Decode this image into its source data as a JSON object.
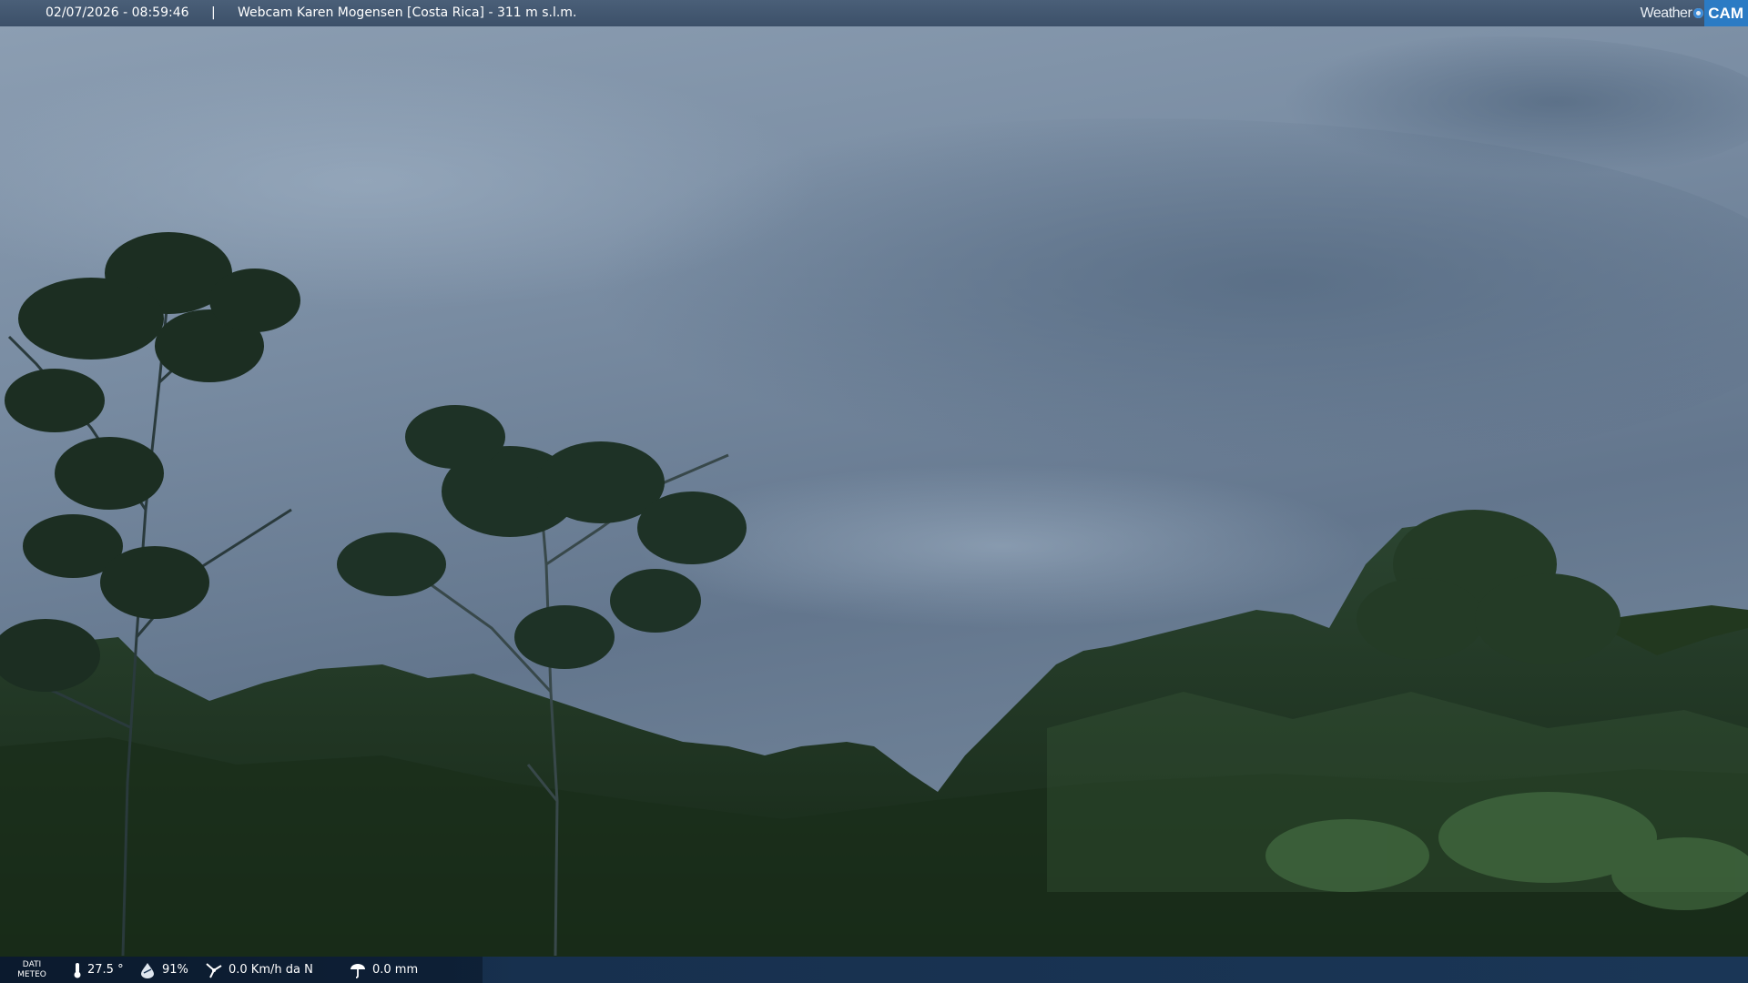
{
  "header": {
    "datetime": "02/07/2026 - 08:59:46",
    "separator": "|",
    "title": "Webcam Karen Mogensen [Costa Rica]  - 311 m s.l.m.",
    "logo_word": "Weather",
    "logo_cam": "CAM"
  },
  "footer": {
    "label_line1": "DATI",
    "label_line2": "METEO",
    "temperature": "27.5 °",
    "humidity": "91%",
    "wind": "0.0 Km/h da N",
    "rain": "0.0 mm"
  },
  "colors": {
    "sky": "#6f8196",
    "forest": "#1f3320",
    "bar": "#3c5069",
    "logo_accent": "#2b7bc4"
  }
}
